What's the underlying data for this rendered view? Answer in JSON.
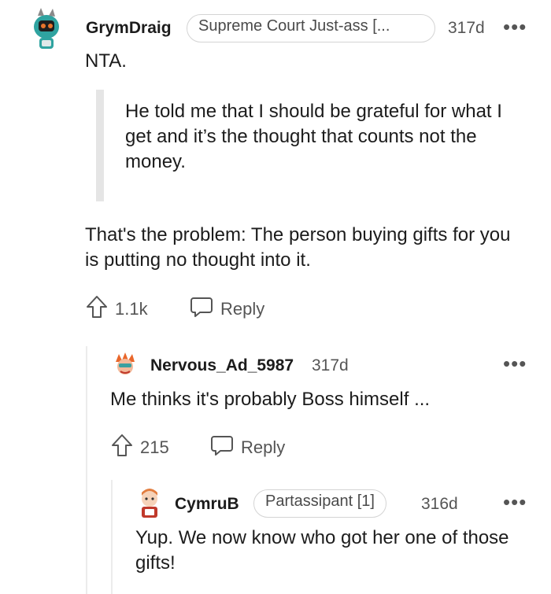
{
  "comments": [
    {
      "username": "GrymDraig",
      "flair": "Supreme Court Just-ass [...",
      "age": "317d",
      "more": "•••",
      "body_first": "NTA.",
      "quote": "He told me that I should be grateful for what I get and it’s the thought that counts not the money.",
      "body_after": "That's the problem: The person buying gifts for you is putting no thought into it.",
      "upvotes": "1.1k",
      "reply_label": "Reply"
    },
    {
      "username": "Nervous_Ad_5987",
      "age": "317d",
      "more": "•••",
      "body": "Me thinks it's probably Boss himself ...",
      "upvotes": "215",
      "reply_label": "Reply"
    },
    {
      "username": "CymruB",
      "flair": "Partassipant [1]",
      "age": "316d",
      "more": "•••",
      "body": "Yup. We now know who got her one of those gifts!"
    }
  ],
  "colors": {
    "text": "#1c1c1c",
    "meta": "#555555",
    "quote_bar": "#e5e5e5",
    "thread_line": "#ececec"
  }
}
